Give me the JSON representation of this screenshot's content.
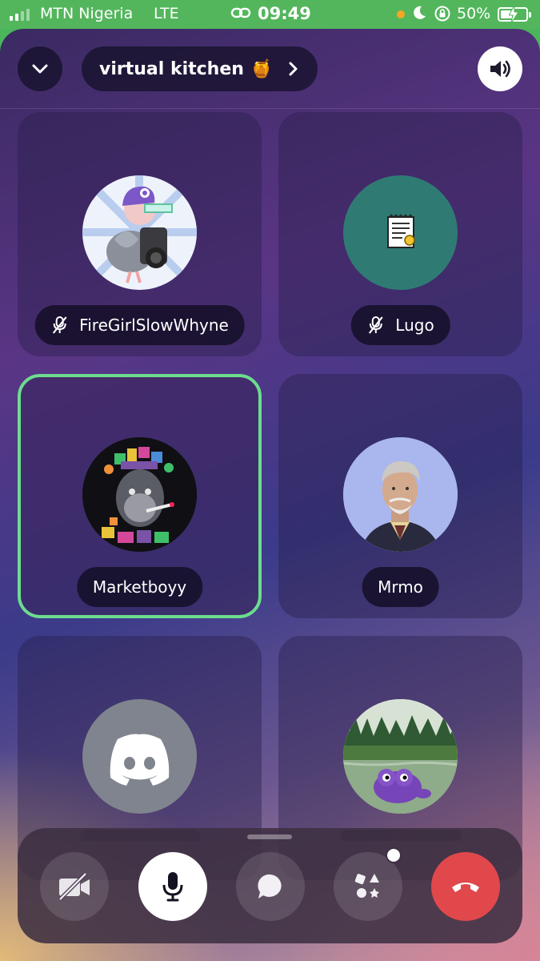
{
  "status_bar": {
    "carrier": "MTN Nigeria",
    "network": "LTE",
    "time": "09:49",
    "battery": "50%"
  },
  "header": {
    "channel_name": "virtual kitchen",
    "channel_emoji": "🍯"
  },
  "participants": [
    {
      "name": "FireGirlSlowWhyne",
      "muted": true,
      "speaking": false,
      "avatar": "cartoon-bird-camera-avatar"
    },
    {
      "name": "Lugo",
      "muted": true,
      "speaking": false,
      "avatar": "notepad-emoji-avatar",
      "avatar_color": "#2f7b74"
    },
    {
      "name": "Marketboyy",
      "muted": false,
      "speaking": true,
      "avatar": "ape-art-avatar"
    },
    {
      "name": "Mrmo",
      "muted": false,
      "speaking": false,
      "avatar": "gentleman-portrait-avatar"
    },
    {
      "name": "",
      "muted": false,
      "speaking": false,
      "avatar": "discord-default-avatar",
      "avatar_color": "#80848e"
    },
    {
      "name": "",
      "muted": false,
      "speaking": false,
      "avatar": "frog-pond-avatar"
    }
  ],
  "colors": {
    "speaking_ring": "#6ddc8e",
    "hangup": "#e0484c",
    "status_bar": "#53b65c"
  },
  "controls": [
    "camera-off",
    "microphone",
    "chat",
    "activities",
    "hang-up"
  ]
}
